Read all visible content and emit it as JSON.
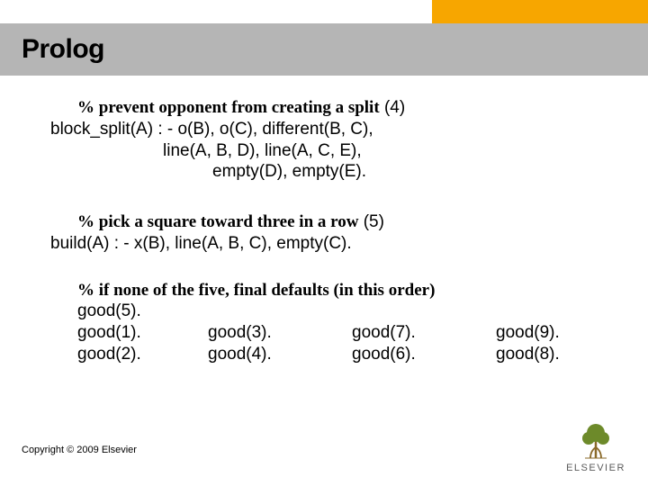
{
  "title": "Prolog",
  "block1": {
    "comment_pre": "% prevent opponent from creating a split",
    "comment_num": "  (4)",
    "line1": "block_split(A) : - o(B), o(C), different(B, C),",
    "line2": "line(A, B, D), line(A, C, E),",
    "line3": "empty(D), empty(E)."
  },
  "block2": {
    "comment_pre": "% pick a square toward three in a row",
    "comment_num": "  (5)",
    "line1": "build(A) : - x(B), line(A, B, C), empty(C)."
  },
  "block3": {
    "comment": "% if none of the five, final defaults (in this order)",
    "r1a": "good(5).",
    "r2a": "good(1).",
    "r2b": "good(3).",
    "r2c": "good(7).",
    "r2d": "good(9).",
    "r3a": "good(2).",
    "r3b": "good(4).",
    "r3c": "good(6).",
    "r3d": "good(8)."
  },
  "copyright": "Copyright © 2009 Elsevier",
  "logo_text": "ELSEVIER"
}
